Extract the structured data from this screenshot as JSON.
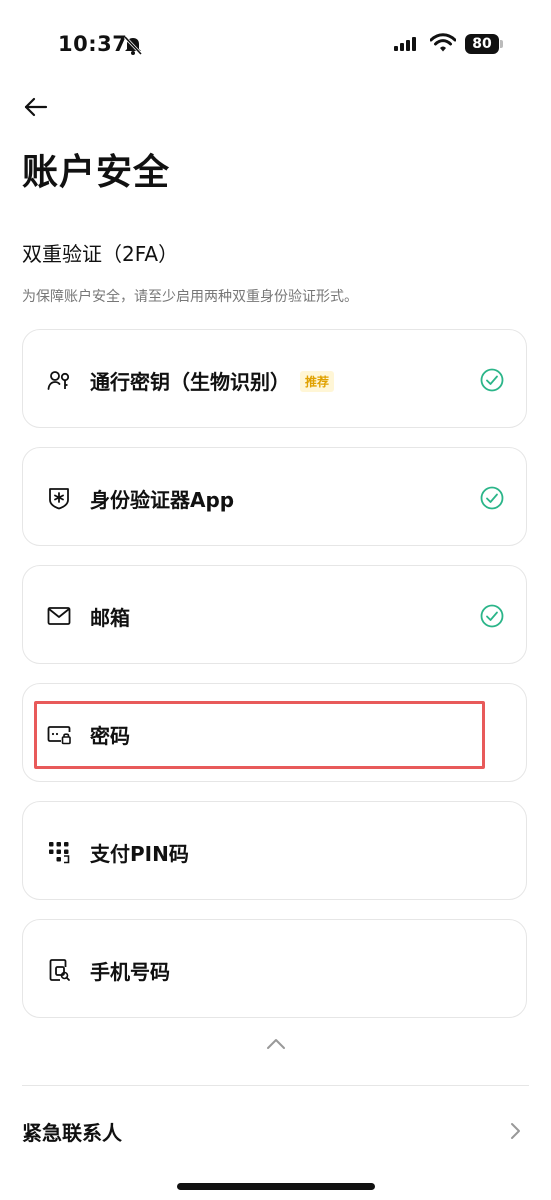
{
  "status_bar": {
    "time": "10:37",
    "battery": "80"
  },
  "header": {
    "title": "账户安全"
  },
  "two_fa": {
    "title": "双重验证（2FA）",
    "description": "为保障账户安全，请至少启用两种双重身份验证形式。"
  },
  "methods": [
    {
      "label": "通行密钥（生物识别）",
      "badge": "推荐",
      "icon": "passkey-icon",
      "enabled": true
    },
    {
      "label": "身份验证器App",
      "icon": "authenticator-icon",
      "enabled": true
    },
    {
      "label": "邮箱",
      "icon": "mail-icon",
      "enabled": true
    },
    {
      "label": "密码",
      "icon": "password-icon",
      "enabled": false
    },
    {
      "label": "支付PIN码",
      "icon": "pin-icon",
      "enabled": false
    },
    {
      "label": "手机号码",
      "icon": "phone-icon",
      "enabled": false
    }
  ],
  "emergency": {
    "label": "紧急联系人"
  },
  "colors": {
    "accent_green": "#2bb589",
    "badge_text": "#e0a100",
    "badge_bg": "#fff6d6",
    "highlight": "#e85a5a"
  }
}
